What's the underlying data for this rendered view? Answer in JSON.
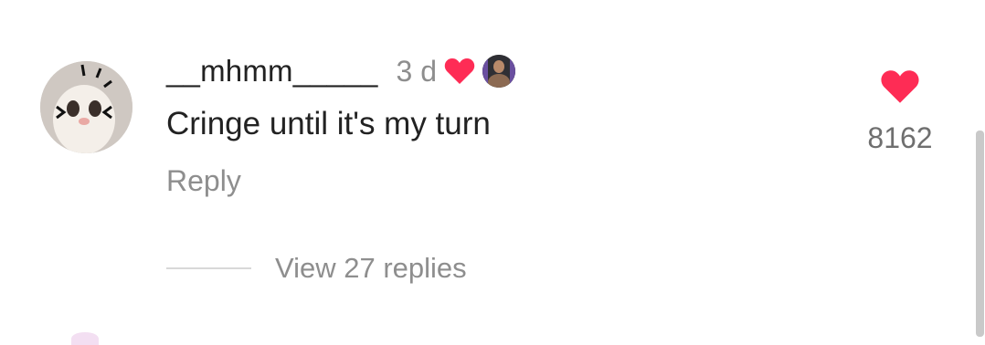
{
  "comment": {
    "username": "__mhmm_____",
    "time_ago": "3 d",
    "text": "Cringe until it's my turn",
    "reply_label": "Reply",
    "like_count": "8162",
    "view_replies_label": "View 27 replies"
  },
  "icons": {
    "creator_heart": "heart-icon",
    "like": "heart-icon"
  },
  "colors": {
    "heart": "#fe2c55",
    "text_primary": "#222222",
    "text_secondary": "#8e8e8e"
  }
}
